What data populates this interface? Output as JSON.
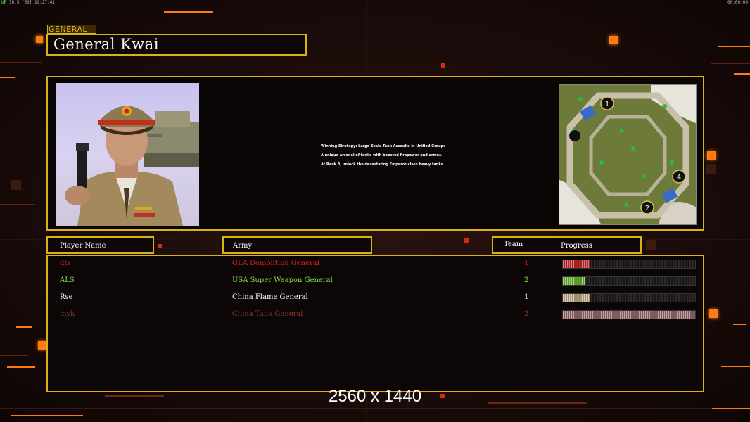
{
  "hud": {
    "left_prefix": "UR",
    "left_fps": "30.5",
    "left_limit": "[60]",
    "left_clock": "19:27:41",
    "right_clock": "00:00:00"
  },
  "general": {
    "tag": "GENERAL",
    "name": "General Kwai",
    "description": [
      "Winning Strategy: Large-Scale Tank Assaults in Unified Groups",
      "A unique arsenal of tanks with boosted firepower and armor.",
      "At Rank 3, unlock the devastating Emperor-class heavy tanks."
    ],
    "map_markers": [
      "1",
      "4",
      "2"
    ]
  },
  "table": {
    "headers": {
      "player": "Player Name",
      "army": "Army",
      "team": "Team",
      "progress": "Progress"
    },
    "rows": [
      {
        "player": "dts",
        "army": "GLA Demolition General",
        "team": "1",
        "progress": 0.21,
        "color": "#e02020",
        "bar_color": "#c83030"
      },
      {
        "player": "ALS",
        "army": "USA Super Weapon General",
        "team": "2",
        "progress": 0.17,
        "color": "#7ee04a",
        "bar_color": "#6ec03a"
      },
      {
        "player": "Rse",
        "army": "China Flame General",
        "team": "1",
        "progress": 0.2,
        "color": "#ffffff",
        "bar_color": "#c8b48a"
      },
      {
        "player": "myk",
        "army": "China Tank General",
        "team": "2",
        "progress": 1.0,
        "color": "#8a3a2a",
        "bar_color": "#a07070"
      }
    ]
  },
  "resolution_label": "2560 x 1440",
  "colors": {
    "frame": "#d9b316",
    "accent": "#ff7a12"
  }
}
